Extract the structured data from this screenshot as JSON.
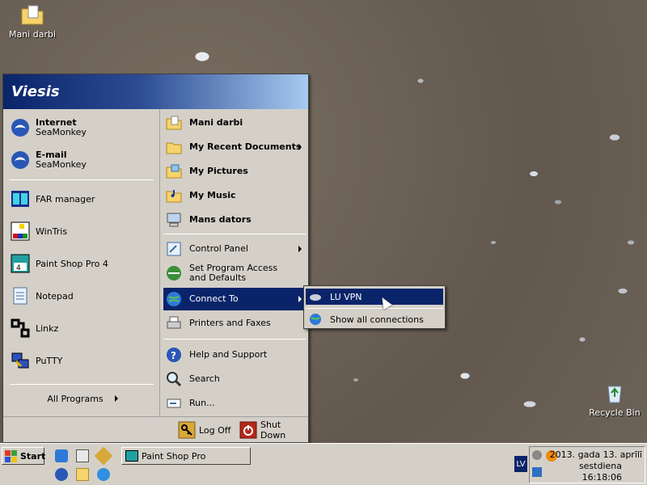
{
  "desktop": {
    "icons": [
      {
        "label": "Mani darbi",
        "icon": "folder-docs-icon"
      },
      {
        "label": "Recycle Bin",
        "icon": "recycle-bin-icon"
      }
    ]
  },
  "start_menu": {
    "user": "Viesis",
    "pinned": [
      {
        "title": "Internet",
        "subtitle": "SeaMonkey",
        "icon": "seamonkey-icon"
      },
      {
        "title": "E-mail",
        "subtitle": "SeaMonkey",
        "icon": "seamonkey-mail-icon"
      }
    ],
    "recent": [
      {
        "label": "FAR manager",
        "icon": "far-manager-icon"
      },
      {
        "label": "WinTris",
        "icon": "wintris-icon"
      },
      {
        "label": "Paint Shop Pro 4",
        "icon": "paint-shop-pro-icon"
      },
      {
        "label": "Notepad",
        "icon": "notepad-icon"
      },
      {
        "label": "Linkz",
        "icon": "linkz-icon"
      },
      {
        "label": "PuTTY",
        "icon": "putty-icon"
      }
    ],
    "all_programs": "All Programs",
    "places": [
      {
        "label": "Mani darbi",
        "icon": "folder-docs-icon"
      },
      {
        "label": "My Recent Documents",
        "icon": "folder-icon"
      },
      {
        "label": "My Pictures",
        "icon": "folder-pictures-icon"
      },
      {
        "label": "My Music",
        "icon": "folder-music-icon"
      },
      {
        "label": "Mans dators",
        "icon": "computer-icon"
      }
    ],
    "system": [
      {
        "label": "Control Panel",
        "icon": "control-panel-icon"
      },
      {
        "label": "Set Program Access and Defaults",
        "icon": "program-access-icon"
      },
      {
        "label": "Connect To",
        "icon": "connect-to-icon"
      },
      {
        "label": "Printers and Faxes",
        "icon": "printer-icon"
      }
    ],
    "help": [
      {
        "label": "Help and Support",
        "icon": "help-icon"
      },
      {
        "label": "Search",
        "icon": "search-icon"
      },
      {
        "label": "Run...",
        "icon": "run-icon"
      }
    ],
    "log_off": "Log Off",
    "shut_down": "Shut Down"
  },
  "connect_submenu": [
    {
      "label": "LU VPN",
      "icon": "vpn-icon"
    },
    {
      "label": "Show all connections",
      "icon": "network-connections-icon"
    }
  ],
  "taskbar": {
    "start_label": "Start",
    "task": "Paint Shop Pro",
    "language": "LV",
    "clock": {
      "date": "2013. gada 13. aprīlī",
      "day": "sestdiena",
      "time": "16:18:06"
    }
  },
  "colors": {
    "highlight": "#0a246a",
    "menu_bg": "#d4d0c8"
  }
}
